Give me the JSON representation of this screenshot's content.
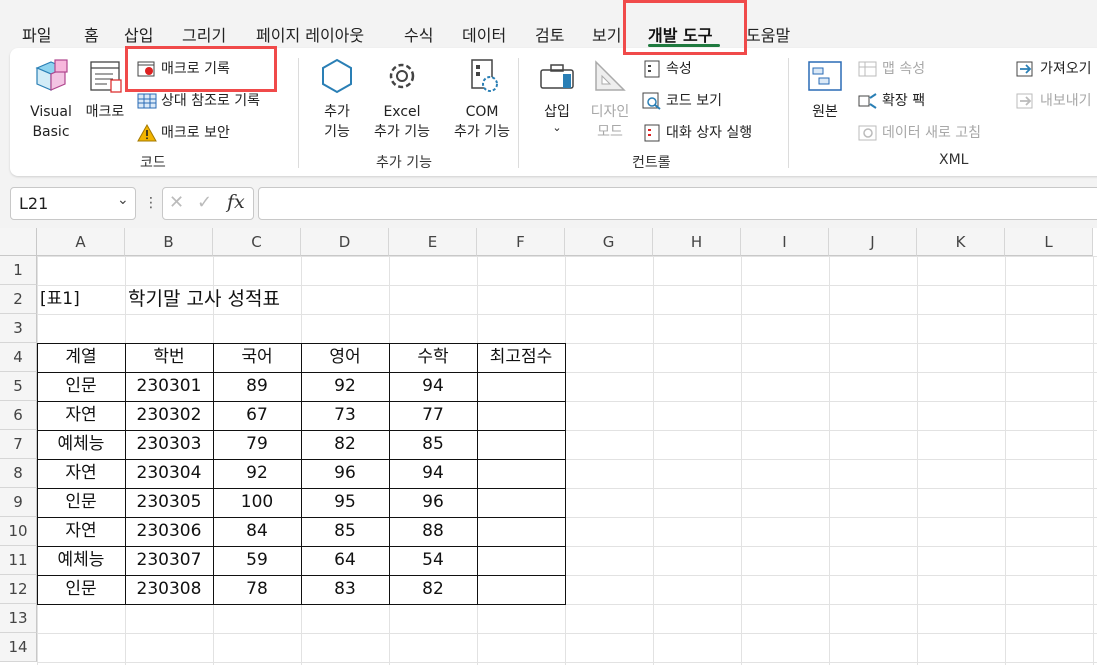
{
  "tabs": [
    "파일",
    "홈",
    "삽입",
    "그리기",
    "페이지 레이아웃",
    "수식",
    "데이터",
    "검토",
    "보기",
    "개발 도구",
    "도움말"
  ],
  "active_tab": "개발 도구",
  "ribbon": {
    "code": {
      "visual_basic": [
        "Visual",
        "Basic"
      ],
      "macro": "매크로",
      "record_macro": "매크로 기록",
      "relative_ref": "상대 참조로 기록",
      "macro_security": "매크로 보안",
      "label": "코드"
    },
    "addins": {
      "addin": [
        "추가",
        "기능"
      ],
      "excel_addin": [
        "Excel",
        "추가 기능"
      ],
      "com_addin": [
        "COM",
        "추가 기능"
      ],
      "label": "추가 기능"
    },
    "controls": {
      "insert": "삽입",
      "design_mode": [
        "디자인",
        "모드"
      ],
      "properties": "속성",
      "view_code": "코드 보기",
      "run_dialog": "대화 상자 실행",
      "label": "컨트롤"
    },
    "xml": {
      "source": "원본",
      "map_properties": "맵 속성",
      "expansion_packs": "확장 팩",
      "refresh_data": "데이터 새로 고침",
      "import": "가져오기",
      "export": "내보내기",
      "label": "XML"
    }
  },
  "formula_bar": {
    "name_box": "L21",
    "fx": "fx",
    "value": ""
  },
  "columns": [
    "A",
    "B",
    "C",
    "D",
    "E",
    "F",
    "G",
    "H",
    "I",
    "J",
    "K",
    "L"
  ],
  "rows": [
    "1",
    "2",
    "3",
    "4",
    "5",
    "6",
    "7",
    "8",
    "9",
    "10",
    "11",
    "12",
    "13",
    "14"
  ],
  "sheet": {
    "table_label": "[표1]",
    "title": "학기말 고사 성적표",
    "headers": [
      "계열",
      "학번",
      "국어",
      "영어",
      "수학",
      "최고점수"
    ],
    "data": [
      [
        "인문",
        "230301",
        "89",
        "92",
        "94",
        ""
      ],
      [
        "자연",
        "230302",
        "67",
        "73",
        "77",
        ""
      ],
      [
        "예체능",
        "230303",
        "79",
        "82",
        "85",
        ""
      ],
      [
        "자연",
        "230304",
        "92",
        "96",
        "94",
        ""
      ],
      [
        "인문",
        "230305",
        "100",
        "95",
        "96",
        ""
      ],
      [
        "자연",
        "230306",
        "84",
        "85",
        "88",
        ""
      ],
      [
        "예체능",
        "230307",
        "59",
        "64",
        "54",
        ""
      ],
      [
        "인문",
        "230308",
        "78",
        "83",
        "82",
        ""
      ]
    ]
  },
  "colors": {
    "accent_green": "#1f7a3f",
    "highlight_red": "#f04a4a"
  }
}
